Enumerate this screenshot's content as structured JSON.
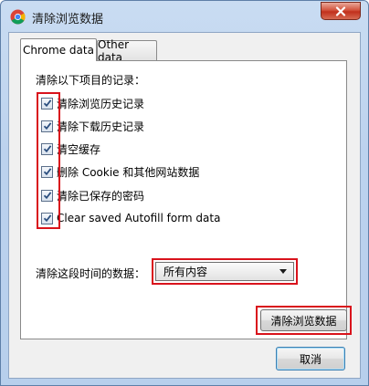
{
  "window": {
    "title": "清除浏览数据"
  },
  "tabs": [
    {
      "label": "Chrome data",
      "active": true
    },
    {
      "label": "Other data",
      "active": false
    }
  ],
  "panel": {
    "heading": "清除以下项目的记录：",
    "options": [
      {
        "label": "清除浏览历史记录",
        "checked": true
      },
      {
        "label": "清除下载历史记录",
        "checked": true
      },
      {
        "label": "清空缓存",
        "checked": true
      },
      {
        "label": "删除 Cookie 和其他网站数据",
        "checked": true
      },
      {
        "label": "清除已保存的密码",
        "checked": true
      },
      {
        "label": "Clear saved Autofill form data",
        "checked": true
      }
    ],
    "range_label": "清除这段时间的数据：",
    "range_value": "所有内容",
    "clear_button": "清除浏览数据"
  },
  "footer": {
    "cancel_button": "取消"
  },
  "colors": {
    "highlight_red": "#d9131c",
    "check_blue": "#2c4f7f",
    "default_button_border": "#3c7fb1"
  }
}
